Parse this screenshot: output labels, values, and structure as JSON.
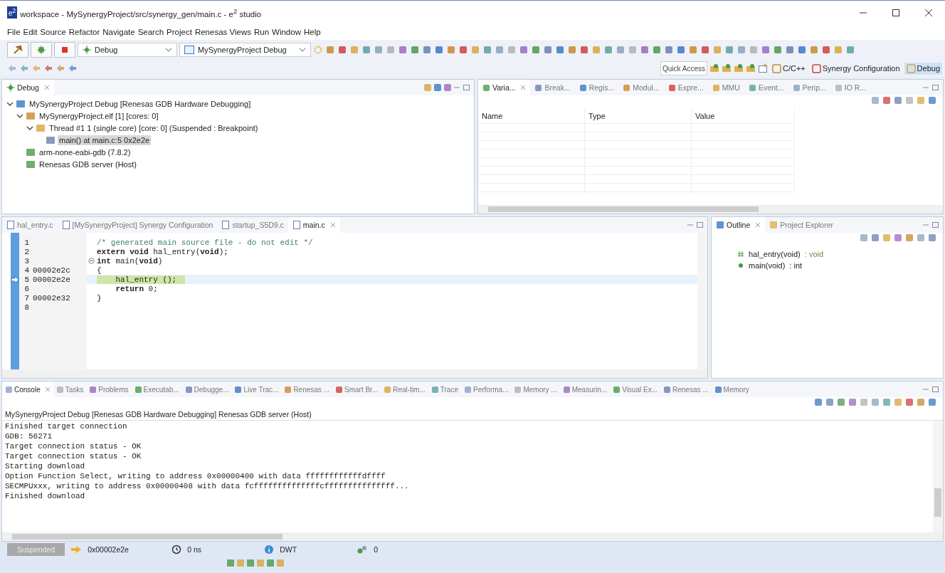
{
  "window": {
    "logo": "e$^{2}$",
    "title": "workspace - MySynergyProject/src/synergy_gen/main.c - e$^{2}$ studio"
  },
  "menu": [
    "File",
    "Edit",
    "Source",
    "Refactor",
    "Navigate",
    "Search",
    "Project",
    "Renesas Views",
    "Run",
    "Window",
    "Help"
  ],
  "toolbar": {
    "configuration": "Debug",
    "launch": "MySynergyProject Debug"
  },
  "quick_access": {
    "placeholder": "Quick Access"
  },
  "perspectives": [
    {
      "label": "C/C++",
      "selected": false
    },
    {
      "label": "Synergy Configuration",
      "selected": false
    },
    {
      "label": "Debug",
      "selected": true
    }
  ],
  "debug_view": {
    "title": "Debug",
    "tree": [
      {
        "label": "MySynergyProject Debug [Renesas GDB Hardware Debugging]",
        "kind": "launch",
        "expanded": true,
        "selected": false,
        "children": [
          {
            "label": "MySynergyProject.elf [1] [cores: 0]",
            "kind": "process",
            "expanded": true,
            "selected": false,
            "children": [
              {
                "label": "Thread #1 1 (single core) [core: 0] (Suspended : Breakpoint)",
                "kind": "thread",
                "expanded": true,
                "selected": false,
                "children": [
                  {
                    "label": "main() at main.c:5 0x2e2e",
                    "kind": "frame",
                    "selected": true
                  }
                ]
              }
            ]
          },
          {
            "label": "arm-none-eabi-gdb (7.8.2)",
            "kind": "gdb",
            "selected": false
          },
          {
            "label": "Renesas GDB server (Host)",
            "kind": "gdb",
            "selected": false
          }
        ]
      }
    ]
  },
  "variables_view": {
    "tabs": [
      {
        "label": "Varia...",
        "selected": true
      },
      {
        "label": "Break...",
        "selected": false
      },
      {
        "label": "Regis...",
        "selected": false
      },
      {
        "label": "Modul...",
        "selected": false
      },
      {
        "label": "Expre...",
        "selected": false
      },
      {
        "label": "MMU",
        "selected": false
      },
      {
        "label": "Event...",
        "selected": false
      },
      {
        "label": "Perip...",
        "selected": false
      },
      {
        "label": "IO R...",
        "selected": false
      }
    ],
    "columns": [
      "Name",
      "Type",
      "Value"
    ]
  },
  "editor": {
    "tabs": [
      {
        "label": "hal_entry.c",
        "selected": false
      },
      {
        "label": "[MySynergyProject] Synergy Configuration",
        "selected": false
      },
      {
        "label": "startup_S5D9.c",
        "selected": false
      },
      {
        "label": "main.c",
        "selected": true
      }
    ],
    "lines": [
      {
        "number": "1",
        "kind": "comment",
        "code": "/* generated main source file - do not edit */",
        "current": false
      },
      {
        "number": "2",
        "kind": "code",
        "code": "**extern** **void** hal_entry(**void**);",
        "current": false
      },
      {
        "number": "3",
        "kind": "fold",
        "code": "**int** main(**void**)",
        "current": false
      },
      {
        "number": "4",
        "address": "00002e2c",
        "kind": "code",
        "code": "{",
        "current": false
      },
      {
        "number": "5",
        "address": "00002e2e",
        "kind": "code",
        "code": "    hal_entry ();",
        "current": true
      },
      {
        "number": "6",
        "kind": "code",
        "code": "    **return** 0;",
        "current": false
      },
      {
        "number": "7",
        "address": "00002e32",
        "kind": "code",
        "code": "}",
        "current": false
      },
      {
        "number": "8",
        "kind": "code",
        "current": false
      }
    ]
  },
  "outline": {
    "tabs": [
      {
        "label": "Outline",
        "selected": true
      },
      {
        "label": "Project Explorer",
        "selected": false
      }
    ],
    "items": [
      {
        "name": "hal_entry(void)",
        "type": " : void",
        "kind": "declaration",
        "selected": false
      },
      {
        "name": "main(void)",
        "type": " : int",
        "kind": "function",
        "selected": false
      }
    ]
  },
  "console_view": {
    "tabs": [
      {
        "label": "Console",
        "selected": true
      },
      {
        "label": "Tasks",
        "selected": false
      },
      {
        "label": "Problems",
        "selected": false
      },
      {
        "label": "Executab...",
        "selected": false
      },
      {
        "label": "Debugge...",
        "selected": false
      },
      {
        "label": "Live Trac...",
        "selected": false
      },
      {
        "label": "Renesas ...",
        "selected": false
      },
      {
        "label": "Smart Br...",
        "selected": false
      },
      {
        "label": "Real-tim...",
        "selected": false
      },
      {
        "label": "Trace",
        "selected": false
      },
      {
        "label": "Performa...",
        "selected": false
      },
      {
        "label": "Memory ...",
        "selected": false
      },
      {
        "label": "Measurin...",
        "selected": false
      },
      {
        "label": "Visual Ex...",
        "selected": false
      },
      {
        "label": "Renesas ...",
        "selected": false
      },
      {
        "label": "Memory",
        "selected": false
      }
    ],
    "title": "MySynergyProject Debug [Renesas GDB Hardware Debugging] Renesas GDB server (Host)",
    "lines": [
      "Finished target connection",
      "GDB: 56271",
      "Target connection status - OK",
      "Target connection status - OK",
      "Starting download",
      "Option Function Select, writing to address 0x00000400 with data ffffffffffffdffff",
      "SECMPUxxx, writing to address 0x00000408 with data fcffffffffffffffcfffffffffffffff...",
      "Finished download"
    ]
  },
  "status_bar": {
    "state": "Suspended",
    "address": "0x00002e2e",
    "time": "0 ns",
    "trace": "DWT",
    "count": "0"
  }
}
